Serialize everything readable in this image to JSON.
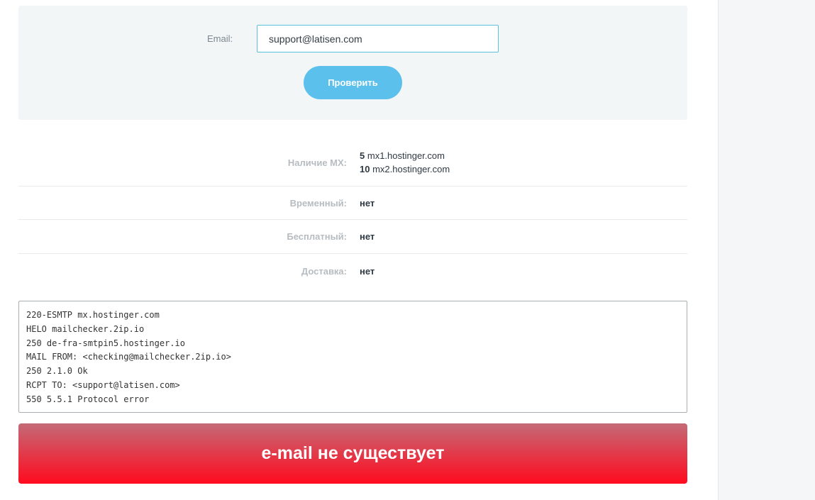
{
  "form": {
    "email_label": "Email:",
    "email_value": "support@latisen.com",
    "check_button": "Проверить"
  },
  "results": {
    "mx_label": "Наличие MX:",
    "mx_records": [
      {
        "priority": "5",
        "host": "mx1.hostinger.com"
      },
      {
        "priority": "10",
        "host": "mx2.hostinger.com"
      }
    ],
    "temporary_label": "Временный:",
    "temporary_value": "нет",
    "free_label": "Бесплатный:",
    "free_value": "нет",
    "delivery_label": "Доставка:",
    "delivery_value": "нет"
  },
  "smtp_log": [
    "220-ESMTP mx.hostinger.com",
    "HELO mailchecker.2ip.io",
    "250 de-fra-smtpin5.hostinger.io",
    "MAIL FROM: <checking@mailchecker.2ip.io>",
    "250 2.1.0 Ok",
    "RCPT TO: <support@latisen.com>",
    "550 5.5.1 Protocol error"
  ],
  "verdict": {
    "text": "e-mail не существует",
    "gradient_top": "#c46a77",
    "gradient_bottom": "#ff0a1e"
  },
  "colors": {
    "accent": "#5bc0eb",
    "panel_bg": "#f3f6f6"
  }
}
